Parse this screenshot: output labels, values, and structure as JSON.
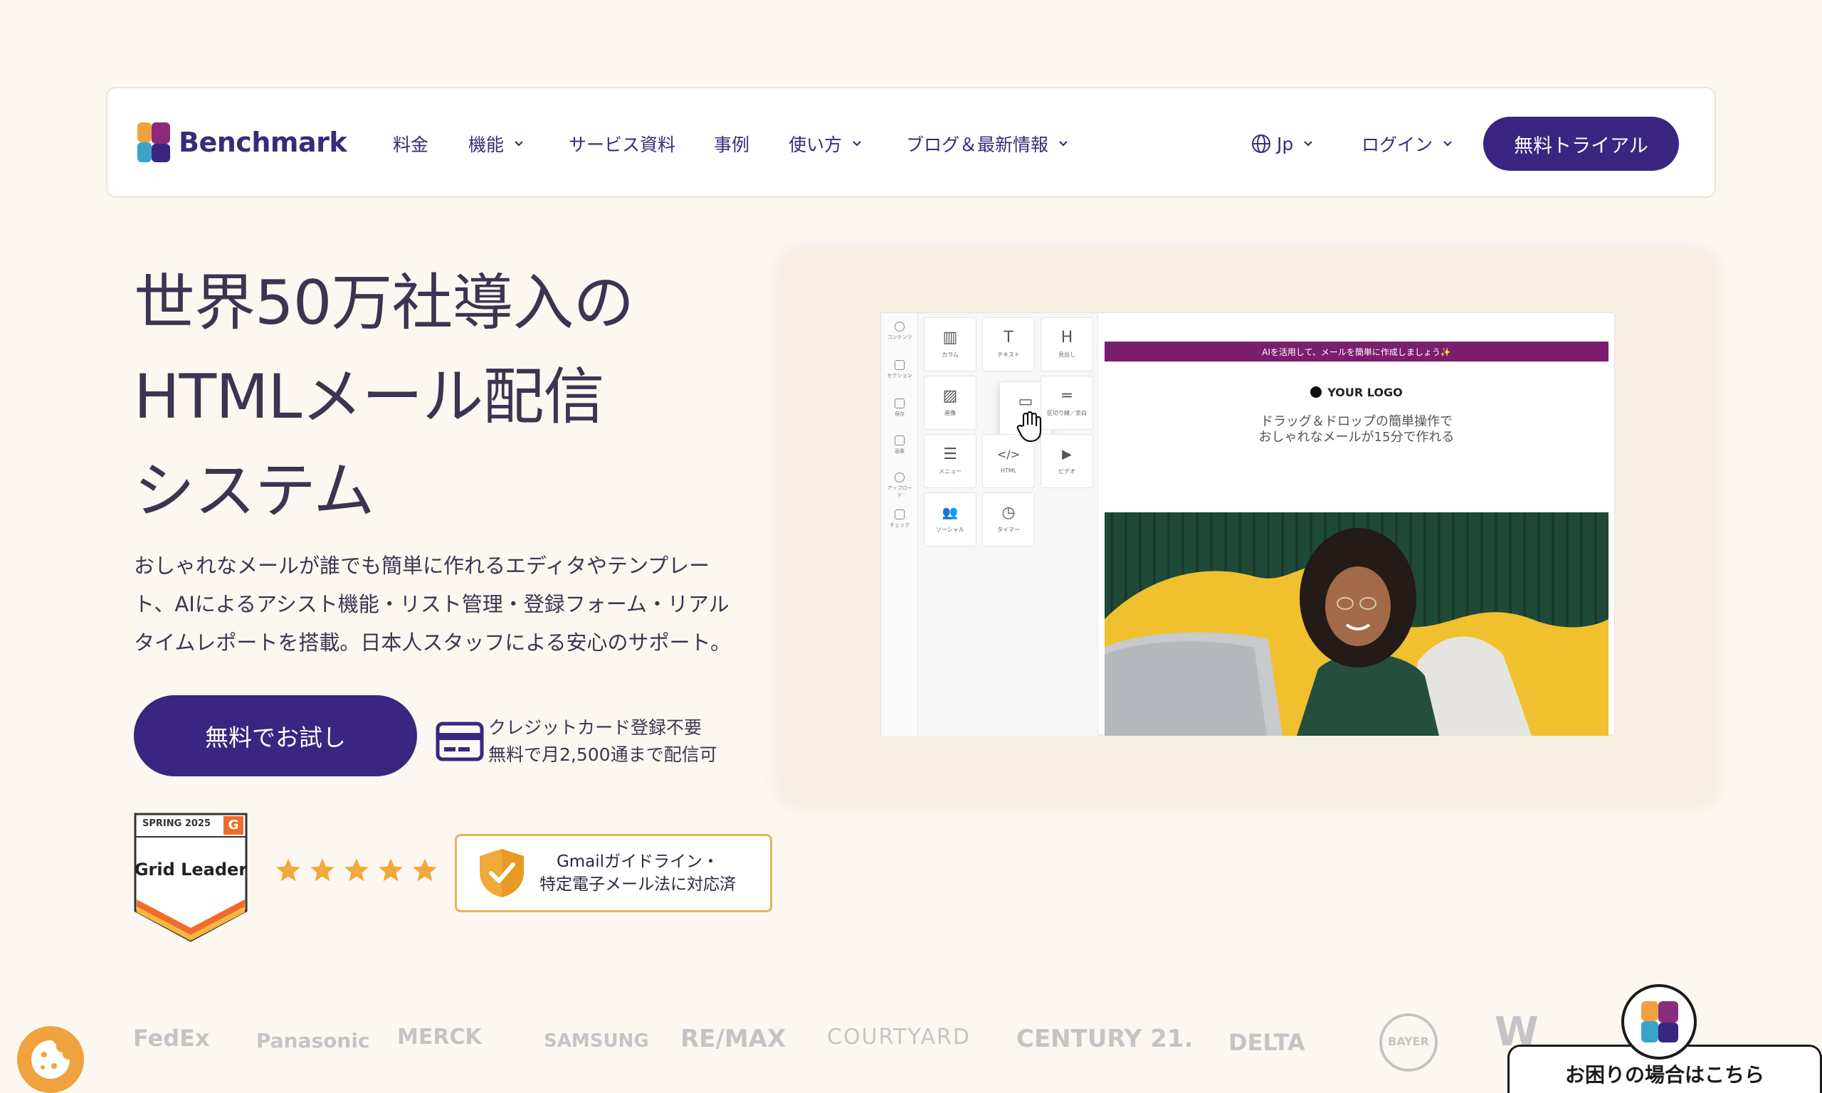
{
  "nav": {
    "logo_text": "Benchmark",
    "items": [
      {
        "label": "料金"
      },
      {
        "label": "機能"
      },
      {
        "label": "サービス資料"
      },
      {
        "label": "事例"
      },
      {
        "label": "使い方"
      },
      {
        "label": "ブログ＆最新情報"
      }
    ],
    "language": "Jp",
    "login": "ログイン",
    "trial": "無料トライアル"
  },
  "hero": {
    "title_lines": [
      "世界50万社導入の",
      "HTMLメール配信",
      "システム"
    ],
    "description_lines": [
      "おしゃれなメールが誰でも簡単に作れるエディタやテンプレー",
      "ト、AIによるアシスト機能・リスト管理・登録フォーム・リアル",
      "タイムレポートを搭載。日本人スタッフによる安心のサポート。"
    ],
    "cta": "無料でお試し",
    "note_lines": [
      "クレジットカード登録不要",
      "無料で月2,500通まで配信可"
    ]
  },
  "badges": {
    "g2_season": "SPRING 2025",
    "g2_title": "Grid Leader",
    "g2_mark": "G",
    "stars": 5,
    "gmail_lines": [
      "Gmailガイドライン・",
      "特定電子メール法に対応済"
    ]
  },
  "editor": {
    "rail": [
      "コンテンツ",
      "セクション",
      "保存",
      "画像",
      "アップロード",
      "チェック"
    ],
    "tiles": [
      {
        "icon": "▥",
        "label": "カラム"
      },
      {
        "icon": "T",
        "label": "テキスト"
      },
      {
        "icon": "H",
        "label": "見出し"
      },
      {
        "icon": "▨",
        "label": "画像"
      },
      {
        "icon": "▭",
        "label": ""
      },
      {
        "icon": "═",
        "label": "区切り線／余白"
      },
      {
        "icon": "☰",
        "label": "メニュー"
      },
      {
        "icon": "</>",
        "label": "HTML"
      },
      {
        "icon": "▶",
        "label": "ビデオ"
      },
      {
        "icon": "👥",
        "label": "ソーシャル"
      },
      {
        "icon": "◷",
        "label": "タイマー"
      }
    ],
    "banner": "AIを活用して、メールを簡単に作成しましょう✨",
    "logo": "YOUR LOGO",
    "copy_lines": [
      "ドラッグ＆ドロップの簡単操作で",
      "おしゃれなメールが15分で作れる"
    ]
  },
  "brands": [
    "FedEx",
    "Panasonic",
    "MERCK",
    "SAMSUNG",
    "RE/MAX",
    "COURTYARD",
    "CENTURY 21.",
    "DELTA",
    "BAYER",
    "W"
  ],
  "help": "お困りの場合はこちら",
  "colors": {
    "brand": "#3a2580",
    "accent": "#e8b257",
    "background": "#fcf8f1"
  }
}
